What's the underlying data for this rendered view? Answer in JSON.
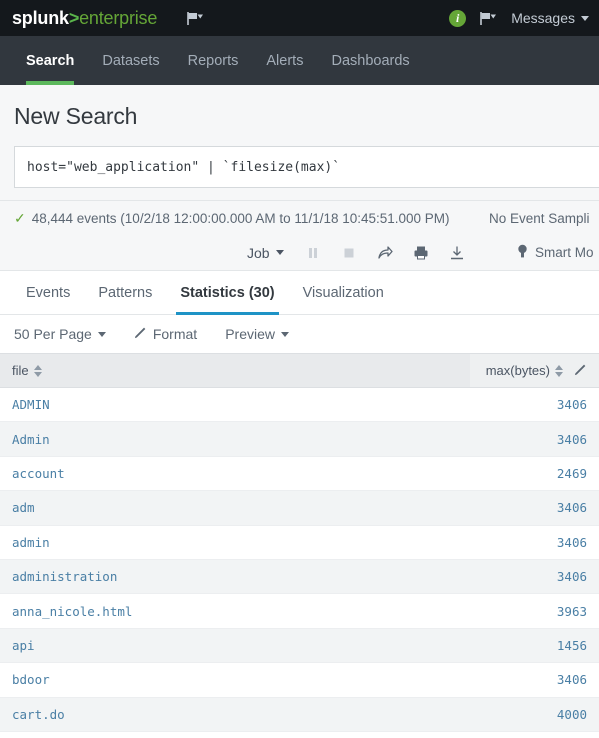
{
  "header": {
    "logo_splunk": "splunk",
    "logo_gt": ">",
    "logo_enterprise": "enterprise",
    "info_badge": "i",
    "messages_label": "Messages",
    "flag_icon_name": "flag-dropdown-icon",
    "brand_green": "#65a637",
    "bar_bg": "#14181c"
  },
  "appnav": {
    "items": [
      {
        "label": "Search",
        "active": true
      },
      {
        "label": "Datasets",
        "active": false
      },
      {
        "label": "Reports",
        "active": false
      },
      {
        "label": "Alerts",
        "active": false
      },
      {
        "label": "Dashboards",
        "active": false
      }
    ],
    "active_underline_color": "#5cb85c",
    "bg": "#31373e"
  },
  "search": {
    "page_title": "New Search",
    "query": "host=\"web_application\" | `filesize(max)`"
  },
  "status": {
    "check": "✓",
    "events_text": "48,444 events (10/2/18 12:00:00.000 AM to 11/1/18 10:45:51.000 PM)",
    "event_sampling": "No Event Sampli"
  },
  "job_toolbar": {
    "job_label": "Job",
    "pause_icon": "pause-icon",
    "stop_icon": "stop-icon",
    "share_icon": "share-icon",
    "print_icon": "print-icon",
    "export_icon": "download-icon",
    "smart_mode_label": "Smart Mo",
    "smart_mode_icon": "lightbulb-icon"
  },
  "result_tabs": [
    {
      "label": "Events",
      "active": false
    },
    {
      "label": "Patterns",
      "active": false
    },
    {
      "label": "Statistics (30)",
      "active": true
    },
    {
      "label": "Visualization",
      "active": false
    }
  ],
  "controls": {
    "per_page": "50 Per Page",
    "format": "Format",
    "preview": "Preview"
  },
  "table": {
    "columns": [
      {
        "label": "file",
        "align": "left"
      },
      {
        "label": "max(bytes)",
        "align": "right"
      }
    ],
    "rows": [
      {
        "file": "ADMIN",
        "max_bytes": "3406"
      },
      {
        "file": "Admin",
        "max_bytes": "3406"
      },
      {
        "file": "account",
        "max_bytes": "2469"
      },
      {
        "file": "adm",
        "max_bytes": "3406"
      },
      {
        "file": "admin",
        "max_bytes": "3406"
      },
      {
        "file": "administration",
        "max_bytes": "3406"
      },
      {
        "file": "anna_nicole.html",
        "max_bytes": "3963"
      },
      {
        "file": "api",
        "max_bytes": "1456"
      },
      {
        "file": "bdoor",
        "max_bytes": "3406"
      },
      {
        "file": "cart.do",
        "max_bytes": "4000"
      }
    ]
  }
}
